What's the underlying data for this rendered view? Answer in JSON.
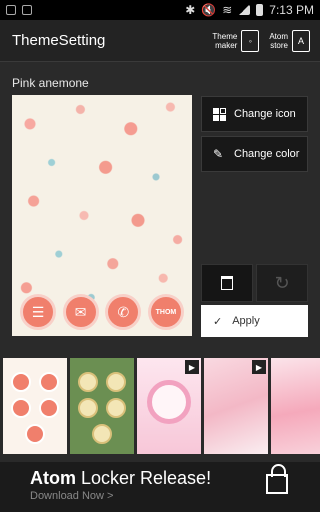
{
  "status_bar": {
    "time": "7:13 PM"
  },
  "header": {
    "title": "ThemeSetting",
    "theme_maker_line1": "Theme",
    "theme_maker_line2": "maker",
    "atom_store_line1": "Atom",
    "atom_store_line2": "store"
  },
  "theme": {
    "name": "Pink anemone",
    "dock_label": "THOM"
  },
  "actions": {
    "change_icon": "Change icon",
    "change_color": "Change color",
    "apply": "Apply"
  },
  "ad": {
    "title_bold": "Atom",
    "title_rest": " Locker Release",
    "title_end": "!",
    "subtitle": "Download Now >"
  },
  "icons": [
    "android-icon",
    "image-icon",
    "bluetooth-icon",
    "mute-icon",
    "wifi-icon",
    "signal-icon",
    "battery-icon",
    "notebook-icon",
    "store-icon",
    "grid-icon",
    "pencil-icon",
    "trash-icon",
    "undo-icon",
    "check-icon",
    "play-icon",
    "lock-icon"
  ]
}
